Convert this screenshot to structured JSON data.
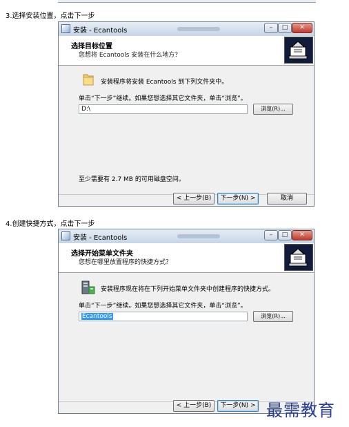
{
  "steps": [
    {
      "caption": "3.选择安装位置，点击下一步",
      "window_title": "安装 - Ecantools",
      "header_title": "选择目标位置",
      "header_subtitle": "您想将 Ecantools 安装在什么地方？",
      "info_text": "安装程序将安装 Ecantools 到下列文件夹中。",
      "instruction": "单击“下一步”继续。如果您想选择其它文件夹，单击“浏览”。",
      "input_value": "D:\\",
      "browse_label": "浏览(R)...",
      "space_required": "至少需要有 2.7 MB 的可用磁盘空间。",
      "buttons": {
        "back": "< 上一步(B)",
        "next": "下一步(N) >",
        "cancel": "取消"
      }
    },
    {
      "caption": "4.创建快捷方式，点击下一步",
      "window_title": "安装 - Ecantools",
      "header_title": "选择开始菜单文件夹",
      "header_subtitle": "您想在哪里放置程序的快捷方式？",
      "info_text": "安装程序现在将在下列开始菜单文件夹中创建程序的快捷方式。",
      "instruction": "单击“下一步”继续。如果您想选择其它文件夹，单击“浏览”。",
      "input_value": "Ecantools",
      "browse_label": "浏览(R)...",
      "buttons": {
        "back": "< 上一步(B)",
        "next": "下一步(N) >"
      }
    }
  ],
  "watermark": "最需教育",
  "colors": {
    "title_bar": "#c6d5e6",
    "selection": "#3399ff",
    "watermark": "#2a3f9a",
    "logo_bg": "#111b3a"
  },
  "icons": {
    "folder": "folder-icon",
    "program_group": "program-group-icon",
    "installer": "installer-logo-icon"
  }
}
